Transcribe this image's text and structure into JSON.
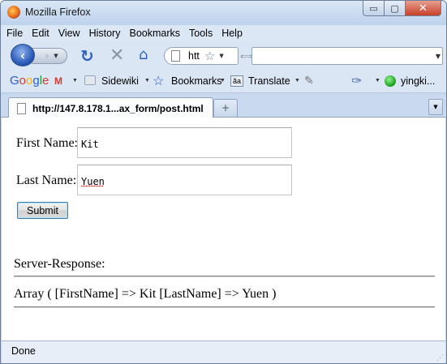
{
  "window": {
    "title": "Mozilla Firefox",
    "buttons": {
      "minimize": "▭",
      "maximize": "▢",
      "close": "✕"
    }
  },
  "menubar": {
    "items": [
      "File",
      "Edit",
      "View",
      "History",
      "Bookmarks",
      "Tools",
      "Help"
    ]
  },
  "navbar": {
    "url": "htt",
    "icons": [
      "back-icon",
      "forward-icon",
      "reload-icon",
      "stop-icon",
      "home-icon",
      "star-icon"
    ]
  },
  "toolbar": {
    "google": "Google",
    "sidewiki": "Sidewiki",
    "bookmarks": "Bookmarks",
    "translate": "Translate",
    "user": "yingki..."
  },
  "tab": {
    "title": "http://147.8.178.1...ax_form/post.html",
    "new_tab": "+"
  },
  "form": {
    "first_name_label": "First Name:",
    "first_name_value": "Kit",
    "last_name_label": "Last Name:",
    "last_name_value": "Yuen",
    "submit_label": "Submit"
  },
  "response": {
    "heading": "Server-Response:",
    "body": "Array ( [FirstName] => Kit [LastName] => Yuen )"
  },
  "status": {
    "text": "Done"
  },
  "colors": {
    "window_frame": "#c5d7ee",
    "toolbar": "#dbe6f4",
    "accent_blue": "#2c62c4",
    "close_red": "#c7402a"
  }
}
